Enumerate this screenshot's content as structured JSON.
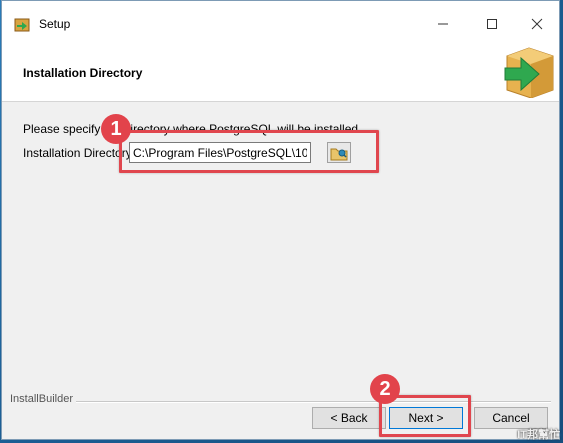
{
  "window": {
    "title": "Setup",
    "controls": {
      "minimize": "minimize",
      "maximize": "maximize",
      "close": "close"
    }
  },
  "header": {
    "title": "Installation Directory"
  },
  "content": {
    "description": "Please specify the directory where PostgreSQL will be installed.",
    "directory_label": "Installation Directory",
    "directory_value": "C:\\Program Files\\PostgreSQL\\10"
  },
  "annotations": {
    "badge1": "1",
    "badge2": "2"
  },
  "footer": {
    "brand": "InstallBuilder",
    "back_label": "< Back",
    "next_label": "Next >",
    "cancel_label": "Cancel"
  },
  "watermark": "IT邦幫忙",
  "colors": {
    "highlight": "#e0464e",
    "badge": "#e2434b",
    "accent": "#0078d7"
  },
  "icons": {
    "app": "setup-box-icon",
    "header": "install-arrow-box-icon",
    "browse": "folder-browse-icon"
  }
}
